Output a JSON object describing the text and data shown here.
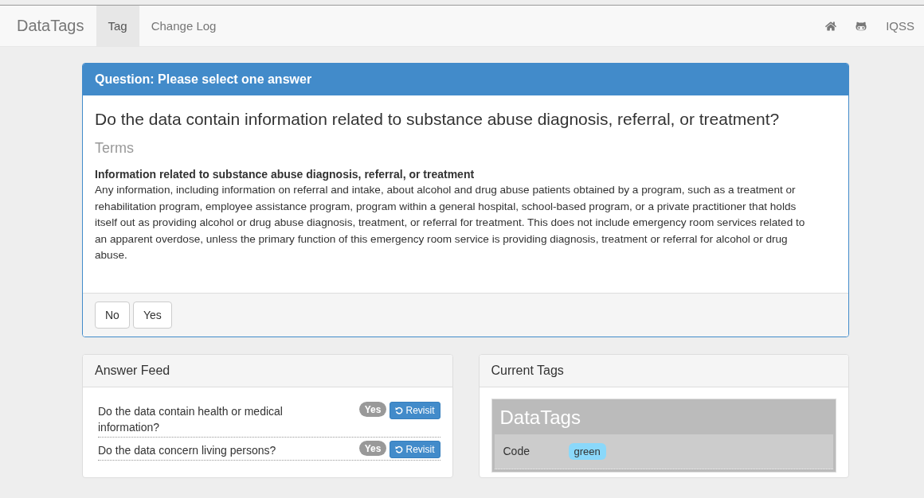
{
  "navbar": {
    "brand": "DataTags",
    "tabs": [
      {
        "label": "Tag",
        "selected": true
      },
      {
        "label": "Change Log",
        "selected": false
      }
    ],
    "right_link": "IQSS"
  },
  "question_panel": {
    "heading": "Question: Please select one answer",
    "question": "Do the data contain information related to substance abuse diagnosis, referral, or treatment?",
    "terms_heading": "Terms",
    "term_title": "Information related to substance abuse diagnosis, referral, or treatment",
    "term_text": "Any information, including information on referral and intake, about alcohol and drug abuse patients obtained by a program, such as a treatment or rehabilitation program, employee assistance program, program within a general hospital, school-based program, or a private practitioner that holds itself out as providing alcohol or drug abuse diagnosis, treatment, or referral for treatment. This does not include emergency room services related to an apparent overdose, unless the primary function of this emergency room service is providing diagnosis, treatment or referral for alcohol or drug abuse.",
    "answers": [
      "No",
      "Yes"
    ]
  },
  "answer_feed": {
    "heading": "Answer Feed",
    "items": [
      {
        "question": "Do the data contain health or medical information?",
        "answer": "Yes",
        "action": "Revisit"
      },
      {
        "question": "Do the data concern living persons?",
        "answer": "Yes",
        "action": "Revisit"
      }
    ]
  },
  "current_tags": {
    "heading": "Current Tags",
    "title": "DataTags",
    "rows": [
      {
        "label": "Code",
        "value": "green",
        "color": "#8ad8fa"
      }
    ]
  }
}
